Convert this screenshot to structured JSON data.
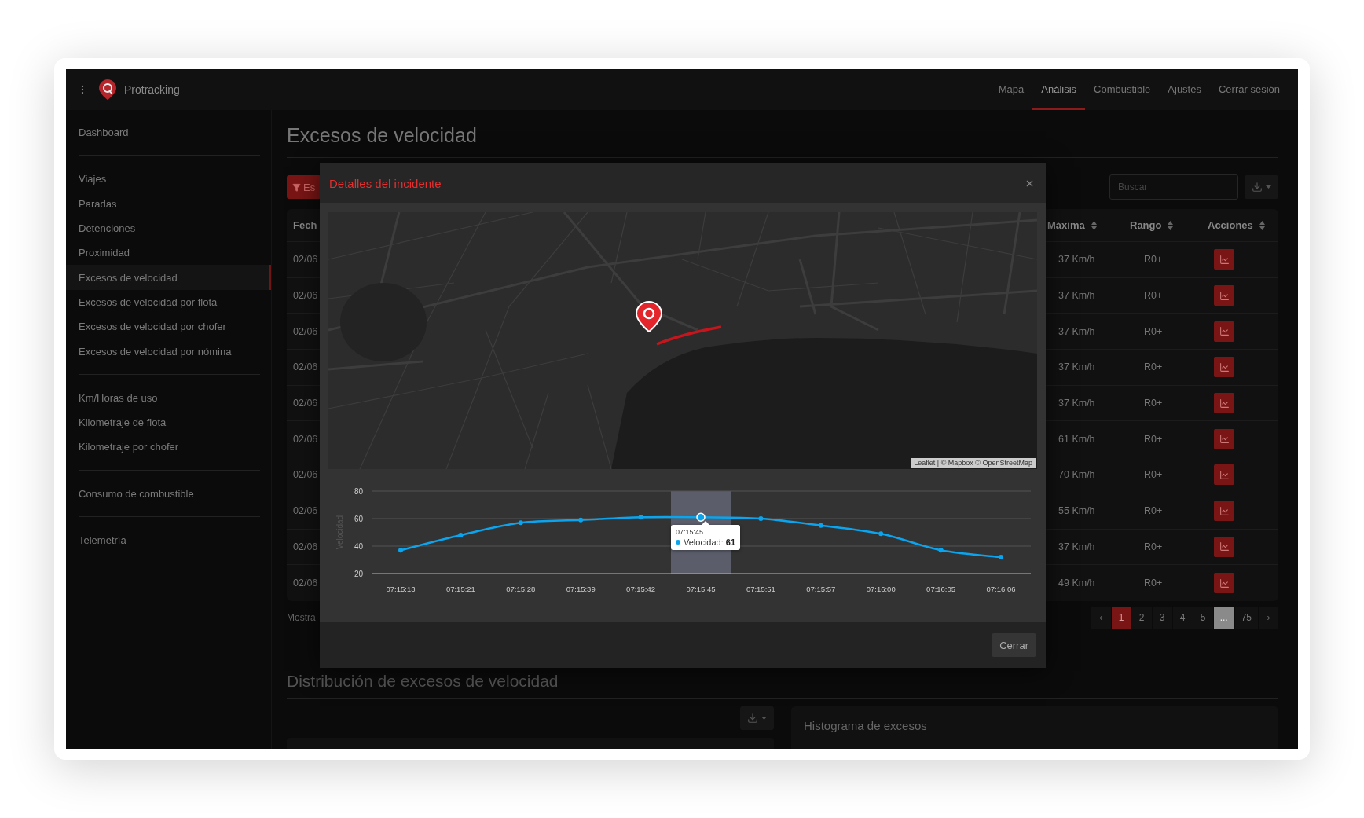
{
  "app": {
    "brand": "Protracking"
  },
  "nav": [
    {
      "label": "Mapa",
      "selected": false
    },
    {
      "label": "Análisis",
      "selected": true
    },
    {
      "label": "Combustible",
      "selected": false
    },
    {
      "label": "Ajustes",
      "selected": false
    },
    {
      "label": "Cerrar sesión",
      "selected": false
    }
  ],
  "sidebar": {
    "groups": [
      {
        "items": [
          {
            "label": "Dashboard",
            "selected": false
          }
        ]
      },
      {
        "items": [
          {
            "label": "Viajes",
            "selected": false
          },
          {
            "label": "Paradas",
            "selected": false
          },
          {
            "label": "Detenciones",
            "selected": false
          },
          {
            "label": "Proximidad",
            "selected": false
          },
          {
            "label": "Excesos de velocidad",
            "selected": true
          },
          {
            "label": "Excesos de velocidad por flota",
            "selected": false
          },
          {
            "label": "Excesos de velocidad por chofer",
            "selected": false
          },
          {
            "label": "Excesos de velocidad por nómina",
            "selected": false
          }
        ]
      },
      {
        "items": [
          {
            "label": "Km/Horas de uso",
            "selected": false
          },
          {
            "label": "Kilometraje de flota",
            "selected": false
          },
          {
            "label": "Kilometraje por chofer",
            "selected": false
          }
        ]
      },
      {
        "items": [
          {
            "label": "Consumo de combustible",
            "selected": false
          }
        ]
      },
      {
        "items": [
          {
            "label": "Telemetría",
            "selected": false
          }
        ]
      }
    ]
  },
  "page": {
    "title": "Excesos de velocidad",
    "filter_button": "Es",
    "search": {
      "placeholder": "Buscar"
    }
  },
  "table": {
    "columns": [
      "Fech",
      "Máxima",
      "Rango",
      "Acciones"
    ],
    "rows": [
      {
        "date": "02/06",
        "max": "37 Km/h",
        "range": "R0+"
      },
      {
        "date": "02/06",
        "max": "37 Km/h",
        "range": "R0+"
      },
      {
        "date": "02/06",
        "max": "37 Km/h",
        "range": "R0+"
      },
      {
        "date": "02/06",
        "max": "37 Km/h",
        "range": "R0+"
      },
      {
        "date": "02/06",
        "max": "37 Km/h",
        "range": "R0+"
      },
      {
        "date": "02/06",
        "max": "61 Km/h",
        "range": "R0+"
      },
      {
        "date": "02/06",
        "max": "70 Km/h",
        "range": "R0+"
      },
      {
        "date": "02/06",
        "max": "55 Km/h",
        "range": "R0+"
      },
      {
        "date": "02/06",
        "max": "37 Km/h",
        "range": "R0+"
      },
      {
        "date": "02/06",
        "max": "49 Km/h",
        "range": "R0+"
      }
    ]
  },
  "footer_text": "Mostra",
  "pagination": [
    {
      "label": "‹",
      "kind": "arrow"
    },
    {
      "label": "1",
      "kind": "page",
      "selected": true
    },
    {
      "label": "2",
      "kind": "page",
      "selected": false
    },
    {
      "label": "3",
      "kind": "page",
      "selected": false
    },
    {
      "label": "4",
      "kind": "page",
      "selected": false
    },
    {
      "label": "5",
      "kind": "page",
      "selected": false
    },
    {
      "label": "...",
      "kind": "ellipsis"
    },
    {
      "label": "75",
      "kind": "page",
      "selected": false
    },
    {
      "label": "›",
      "kind": "arrow"
    }
  ],
  "distribution": {
    "title": "Distribución de excesos de velocidad",
    "histogram_title": "Histograma de excesos"
  },
  "modal": {
    "title": "Detalles del incidente",
    "map": {
      "attribution": "Leaflet | © Mapbox © OpenStreetMap"
    },
    "chart_data": {
      "type": "line",
      "ylabel": "Velocidad",
      "categories": [
        "07:15:13",
        "07:15:21",
        "07:15:28",
        "07:15:39",
        "07:15:42",
        "07:15:45",
        "07:15:51",
        "07:15:57",
        "07:16:00",
        "07:16:05",
        "07:16:06"
      ],
      "series": [
        {
          "color": "#0aa5ee",
          "marker": "o",
          "values": [
            37,
            48,
            57,
            59,
            61,
            61,
            60,
            55,
            49,
            37,
            32
          ]
        }
      ],
      "ylim": [
        20,
        80
      ],
      "yticks": [
        20,
        40,
        60,
        80
      ]
    },
    "tooltip": {
      "time": "07:15:45",
      "label": "Velocidad:",
      "value": "61"
    },
    "close_button": "Cerrar"
  }
}
